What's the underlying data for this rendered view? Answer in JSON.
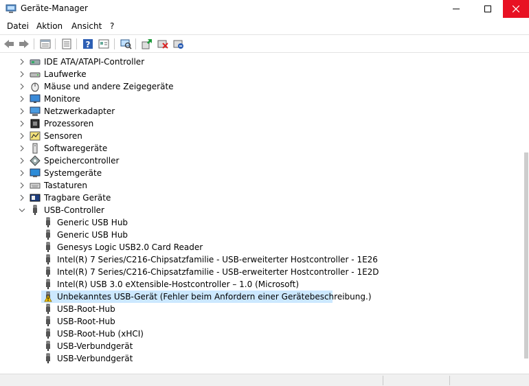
{
  "window": {
    "title": "Geräte-Manager",
    "icon": "device-manager-icon"
  },
  "menu": {
    "items": [
      "Datei",
      "Aktion",
      "Ansicht",
      "?"
    ]
  },
  "toolbar": {
    "buttons": [
      "back-arrow-icon",
      "forward-arrow-icon",
      "properties-grid-icon",
      "list-view-icon",
      "help-icon",
      "device-properties-icon",
      "scan-hardware-icon",
      "update-driver-icon",
      "uninstall-device-icon",
      "disable-device-icon"
    ]
  },
  "tree": {
    "categories": [
      {
        "label": "IDE ATA/ATAPI-Controller",
        "icon": "ide-controller-icon",
        "expanded": false
      },
      {
        "label": "Laufwerke",
        "icon": "disk-drive-icon",
        "expanded": false
      },
      {
        "label": "Mäuse und andere Zeigegeräte",
        "icon": "mouse-icon",
        "expanded": false
      },
      {
        "label": "Monitore",
        "icon": "monitor-icon",
        "expanded": false
      },
      {
        "label": "Netzwerkadapter",
        "icon": "network-adapter-icon",
        "expanded": false
      },
      {
        "label": "Prozessoren",
        "icon": "processor-icon",
        "expanded": false
      },
      {
        "label": "Sensoren",
        "icon": "sensor-icon",
        "expanded": false
      },
      {
        "label": "Softwaregeräte",
        "icon": "software-device-icon",
        "expanded": false
      },
      {
        "label": "Speichercontroller",
        "icon": "storage-controller-icon",
        "expanded": false
      },
      {
        "label": "Systemgeräte",
        "icon": "system-device-icon",
        "expanded": false
      },
      {
        "label": "Tastaturen",
        "icon": "keyboard-icon",
        "expanded": false
      },
      {
        "label": "Tragbare Geräte",
        "icon": "portable-device-icon",
        "expanded": false
      },
      {
        "label": "USB-Controller",
        "icon": "usb-plug-icon",
        "expanded": true
      }
    ],
    "usb_children": [
      {
        "label": "Generic USB Hub",
        "warning": false
      },
      {
        "label": "Generic USB Hub",
        "warning": false
      },
      {
        "label": "Genesys Logic USB2.0 Card Reader",
        "warning": false
      },
      {
        "label": "Intel(R) 7 Series/C216-Chipsatzfamilie - USB-erweiterter Hostcontroller - 1E26",
        "warning": false
      },
      {
        "label": "Intel(R) 7 Series/C216-Chipsatzfamilie - USB-erweiterter Hostcontroller - 1E2D",
        "warning": false
      },
      {
        "label": "Intel(R) USB 3.0 eXtensible-Hostcontroller – 1.0 (Microsoft)",
        "warning": false
      },
      {
        "label": "Unbekanntes USB-Gerät (Fehler beim Anfordern einer Gerätebeschreibung.)",
        "warning": true,
        "selected": true
      },
      {
        "label": "USB-Root-Hub",
        "warning": false
      },
      {
        "label": "USB-Root-Hub",
        "warning": false
      },
      {
        "label": "USB-Root-Hub (xHCI)",
        "warning": false
      },
      {
        "label": "USB-Verbundgerät",
        "warning": false
      },
      {
        "label": "USB-Verbundgerät",
        "warning": false
      }
    ]
  },
  "colors": {
    "selection": "#cce8ff",
    "close_button": "#e81123",
    "warning": "#f5c400"
  }
}
